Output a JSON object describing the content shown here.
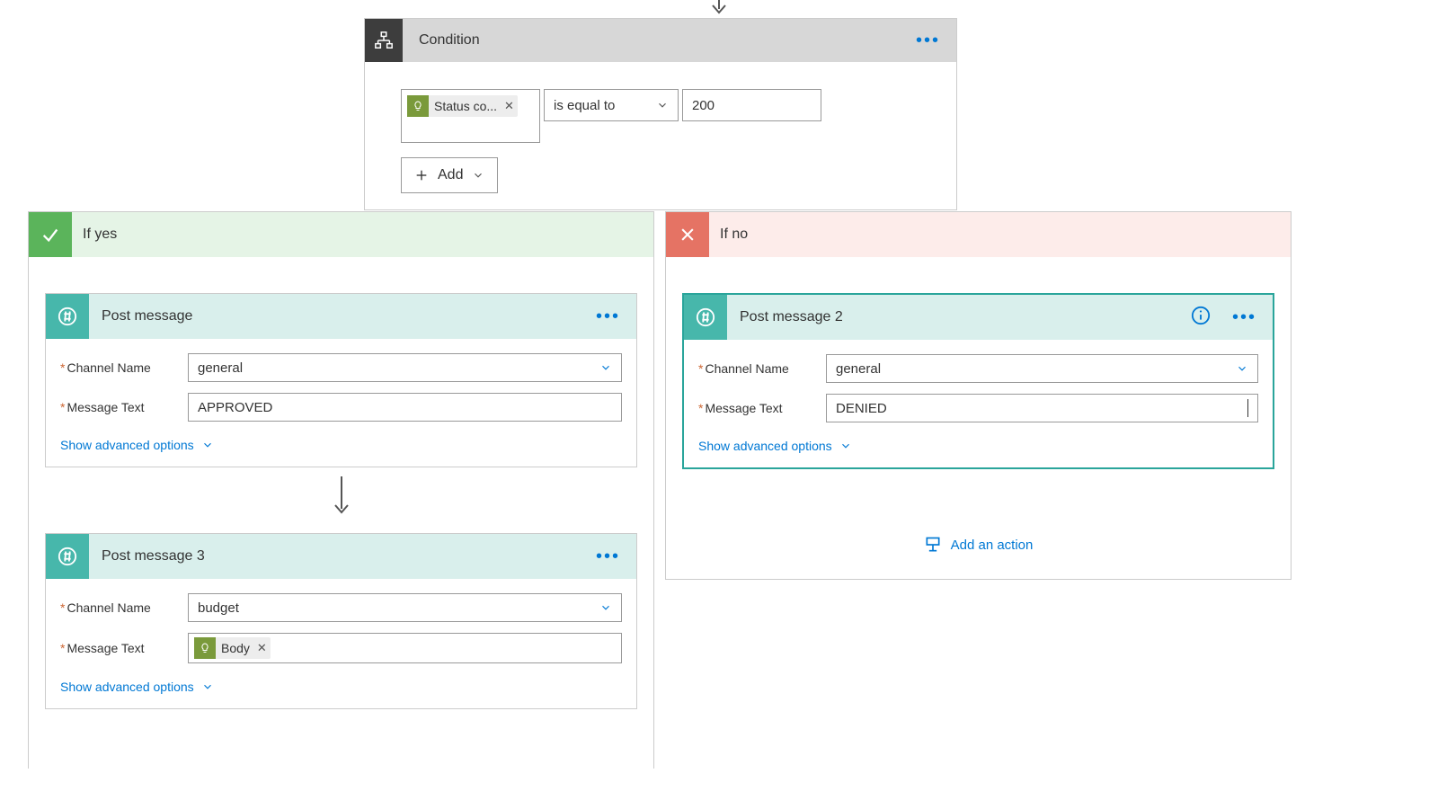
{
  "top_arrow": true,
  "condition": {
    "title": "Condition",
    "token_label": "Status co...",
    "operator": "is equal to",
    "value": "200",
    "add_label": "Add"
  },
  "branches": {
    "yes": {
      "title": "If yes",
      "actions": [
        {
          "title": "Post message",
          "channel_label": "Channel Name",
          "channel_value": "general",
          "message_label": "Message Text",
          "message_value": "APPROVED",
          "advanced": "Show advanced options"
        },
        {
          "title": "Post message 3",
          "channel_label": "Channel Name",
          "channel_value": "budget",
          "message_label": "Message Text",
          "message_token": "Body",
          "advanced": "Show advanced options"
        }
      ]
    },
    "no": {
      "title": "If no",
      "actions": [
        {
          "title": "Post message 2",
          "channel_label": "Channel Name",
          "channel_value": "general",
          "message_label": "Message Text",
          "message_value": "DENIED",
          "advanced": "Show advanced options"
        }
      ],
      "add_action": "Add an action"
    }
  }
}
